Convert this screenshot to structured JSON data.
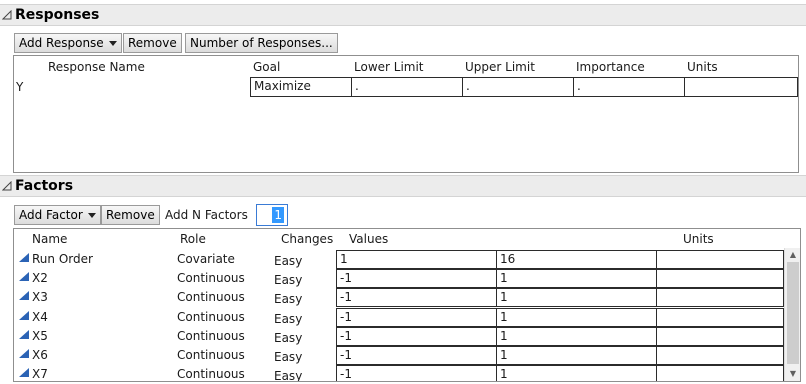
{
  "responses": {
    "title": "Responses",
    "buttons": {
      "add_response": "Add Response",
      "remove": "Remove",
      "number_of_responses": "Number of Responses..."
    },
    "columns": [
      "Response Name",
      "Goal",
      "Lower Limit",
      "Upper Limit",
      "Importance",
      "Units"
    ],
    "rows": [
      {
        "name": "Y",
        "goal": "Maximize",
        "lower": ".",
        "upper": ".",
        "importance": ".",
        "units": ""
      }
    ]
  },
  "factors": {
    "title": "Factors",
    "buttons": {
      "add_factor": "Add Factor",
      "remove": "Remove"
    },
    "add_n_label": "Add N Factors",
    "add_n_value": "1",
    "columns": [
      "Name",
      "Role",
      "Changes",
      "Values",
      "Units"
    ],
    "rows": [
      {
        "name": "Run Order",
        "role": "Covariate",
        "changes": "Easy",
        "v1": "1",
        "v2": "16",
        "units": ""
      },
      {
        "name": "X2",
        "role": "Continuous",
        "changes": "Easy",
        "v1": "-1",
        "v2": "1",
        "units": ""
      },
      {
        "name": "X3",
        "role": "Continuous",
        "changes": "Easy",
        "v1": "-1",
        "v2": "1",
        "units": ""
      },
      {
        "name": "X4",
        "role": "Continuous",
        "changes": "Easy",
        "v1": "-1",
        "v2": "1",
        "units": ""
      },
      {
        "name": "X5",
        "role": "Continuous",
        "changes": "Easy",
        "v1": "-1",
        "v2": "1",
        "units": ""
      },
      {
        "name": "X6",
        "role": "Continuous",
        "changes": "Easy",
        "v1": "-1",
        "v2": "1",
        "units": ""
      },
      {
        "name": "X7",
        "role": "Continuous",
        "changes": "Easy",
        "v1": "-1",
        "v2": "1",
        "units": ""
      }
    ]
  },
  "icons": {
    "disclosure": "disclosure-triangle-icon",
    "continuous": "continuous-factor-icon",
    "dropdown": "chevron-down-icon"
  },
  "colors": {
    "accent": "#2b63b5",
    "selection": "#3399ff",
    "input_border": "#3a7bd5"
  }
}
